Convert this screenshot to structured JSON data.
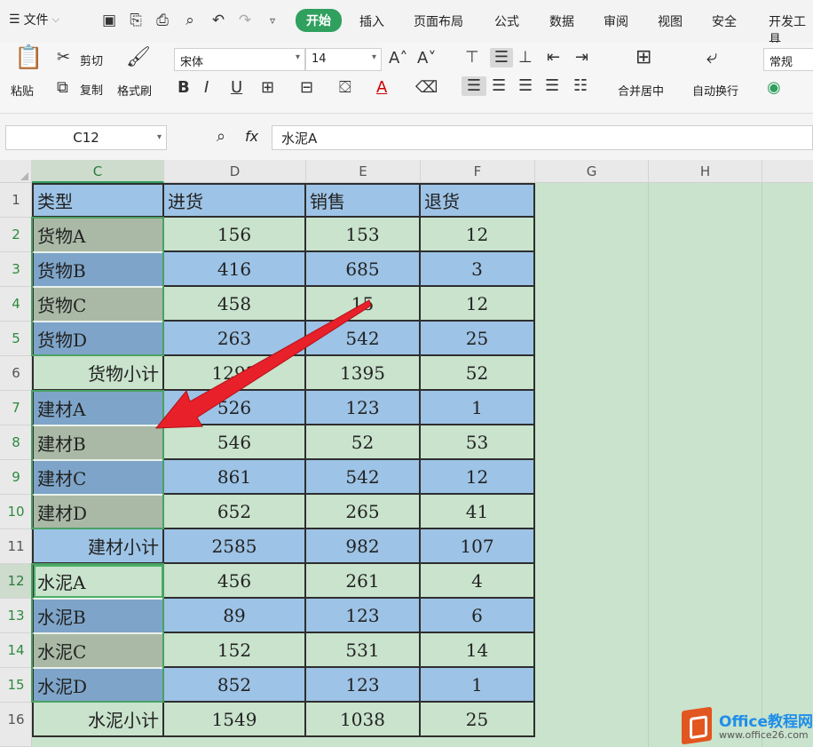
{
  "menu": {
    "file_label": "文件",
    "tabs": [
      "开始",
      "插入",
      "页面布局",
      "公式",
      "数据",
      "审阅",
      "视图",
      "安全",
      "开发工具"
    ],
    "active_tab": "开始"
  },
  "ribbon": {
    "paste": "粘贴",
    "cut": "剪切",
    "copy": "复制",
    "format_painter": "格式刷",
    "font_name": "宋体",
    "font_size": "14",
    "merge_center": "合并居中",
    "wrap_text": "自动换行",
    "number_format": "常规"
  },
  "formula_bar": {
    "cell_ref": "C12",
    "fx": "fx",
    "content": "水泥A"
  },
  "columns": [
    "C",
    "D",
    "E",
    "F",
    "G",
    "H"
  ],
  "row_numbers": [
    "1",
    "2",
    "3",
    "4",
    "5",
    "6",
    "7",
    "8",
    "9",
    "10",
    "11",
    "12",
    "13",
    "14",
    "15",
    "16"
  ],
  "table": {
    "headers": [
      "类型",
      "进货",
      "销售",
      "退货"
    ],
    "rows": [
      [
        "货物A",
        "156",
        "153",
        "12"
      ],
      [
        "货物B",
        "416",
        "685",
        "3"
      ],
      [
        "货物C",
        "458",
        "15",
        "12"
      ],
      [
        "货物D",
        "263",
        "542",
        "25"
      ],
      [
        "货物小计",
        "1293",
        "1395",
        "52"
      ],
      [
        "建材A",
        "526",
        "123",
        "1"
      ],
      [
        "建材B",
        "546",
        "52",
        "53"
      ],
      [
        "建材C",
        "861",
        "542",
        "12"
      ],
      [
        "建材D",
        "652",
        "265",
        "41"
      ],
      [
        "建材小计",
        "2585",
        "982",
        "107"
      ],
      [
        "水泥A",
        "456",
        "261",
        "4"
      ],
      [
        "水泥B",
        "89",
        "123",
        "6"
      ],
      [
        "水泥C",
        "152",
        "531",
        "14"
      ],
      [
        "水泥D",
        "852",
        "123",
        "1"
      ],
      [
        "水泥小计",
        "1549",
        "1038",
        "25"
      ]
    ]
  },
  "watermark": {
    "title": "Office教程网",
    "url": "www.office26.com"
  }
}
